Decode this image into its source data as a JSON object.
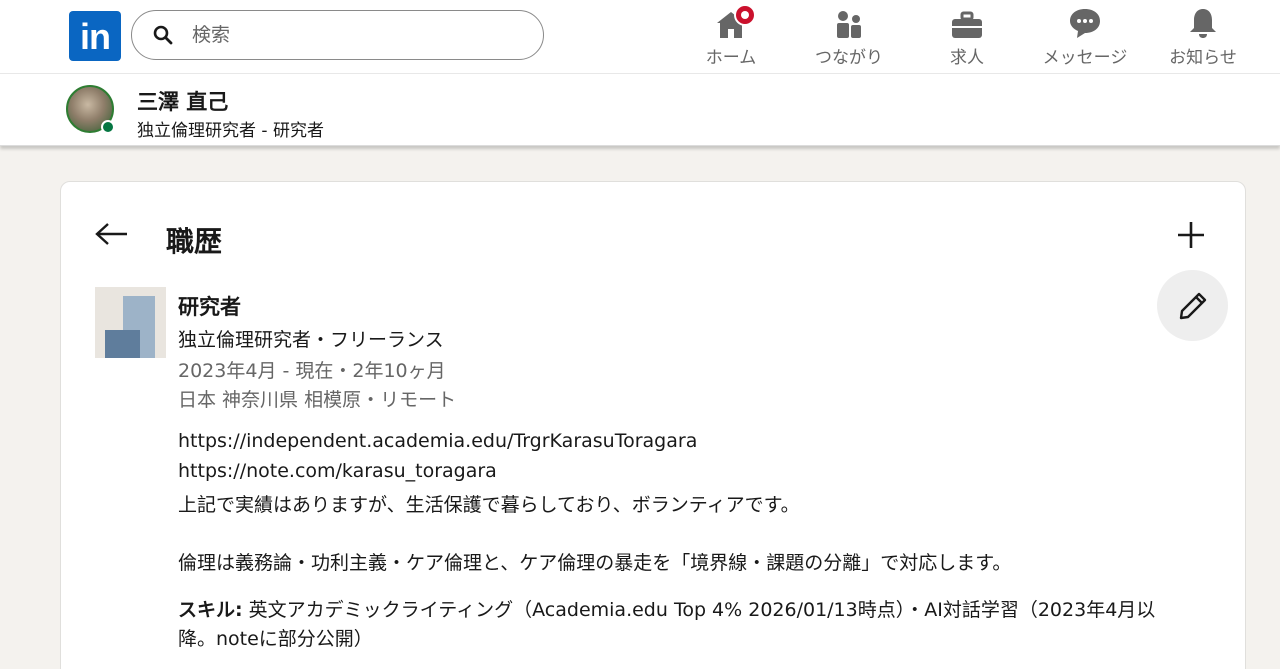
{
  "nav": {
    "logo_text": "in",
    "search_placeholder": "検索",
    "items": [
      {
        "label": "ホーム",
        "icon": "home-icon"
      },
      {
        "label": "つながり",
        "icon": "network-icon"
      },
      {
        "label": "求人",
        "icon": "briefcase-icon"
      },
      {
        "label": "メッセージ",
        "icon": "messaging-icon"
      },
      {
        "label": "お知らせ",
        "icon": "bell-icon"
      }
    ],
    "badge_color": "#cb112d"
  },
  "profile": {
    "name": "三澤 直己",
    "headline": "独立倫理研究者 - 研究者"
  },
  "section": {
    "title": "職歴"
  },
  "experience": {
    "title": "研究者",
    "company": "独立倫理研究者・フリーランス",
    "dates": "2023年4月 - 現在・2年10ヶ月",
    "location": "日本 神奈川県 相模原・リモート",
    "description": [
      "https://independent.academia.edu/TrgrKarasuToragara",
      "https://note.com/karasu_toragara",
      "上記で実績はありますが、生活保護で暮らしており、ボランティアです。",
      "倫理は義務論・功利主義・ケア倫理と、ケア倫理の暴走を「境界線・課題の分離」で対応します。"
    ],
    "skills_label": "スキル:",
    "skills_text": "英文アカデミックライティング（Academia.edu Top 4% 2026/01/13時点）・AI対話学習（2023年4月以降。noteに部分公開）"
  },
  "colors": {
    "brand": "#0a66c2",
    "online": "#057642",
    "muted_text": "#666666"
  }
}
